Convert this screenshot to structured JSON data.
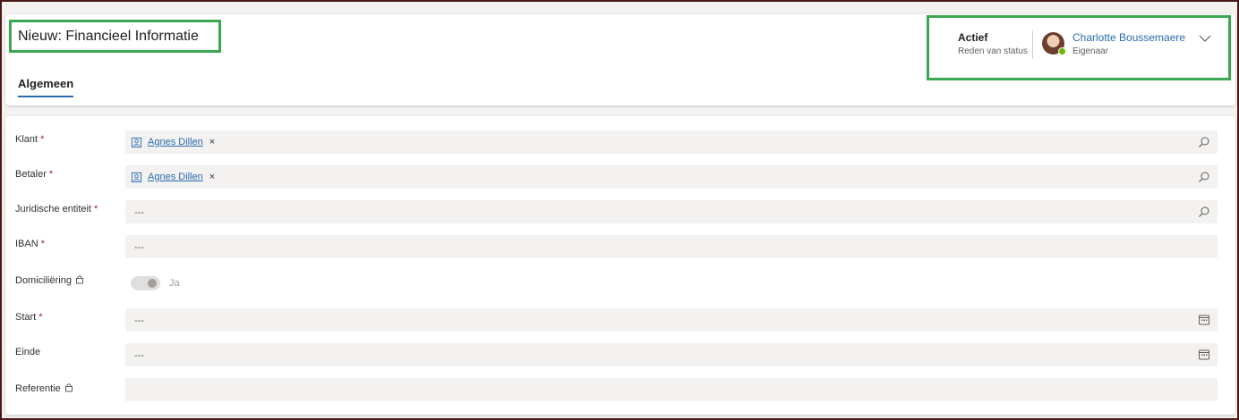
{
  "header": {
    "title": "Nieuw: Financieel Informatie",
    "tab": "Algemeen",
    "status_value": "Actief",
    "status_label": "Reden van status",
    "owner_name": "Charlotte Boussemaere",
    "owner_label": "Eigenaar"
  },
  "form": {
    "fields": [
      {
        "label": "Klant",
        "required": "*",
        "type": "lookup",
        "value": "Agnes Dillen",
        "remove": "×"
      },
      {
        "label": "Betaler",
        "required": "*",
        "type": "lookup",
        "value": "Agnes Dillen",
        "remove": "×"
      },
      {
        "label": "Juridische entiteit",
        "required": "*",
        "type": "lookup",
        "placeholder": "---"
      },
      {
        "label": "IBAN",
        "required": "*",
        "type": "text",
        "placeholder": "---"
      },
      {
        "label": "Domiciliëring",
        "type": "toggle",
        "value": "Ja",
        "locked": true
      },
      {
        "label": "Start",
        "required": "*",
        "type": "date",
        "placeholder": "---"
      },
      {
        "label": "Einde",
        "type": "date",
        "placeholder": "---"
      },
      {
        "label": "Referentie",
        "type": "text",
        "locked": true
      }
    ]
  },
  "colors": {
    "highlight": "#3aa851",
    "accent": "#2b6cb0",
    "required": "#a4262c",
    "presence": "#6bb700"
  }
}
